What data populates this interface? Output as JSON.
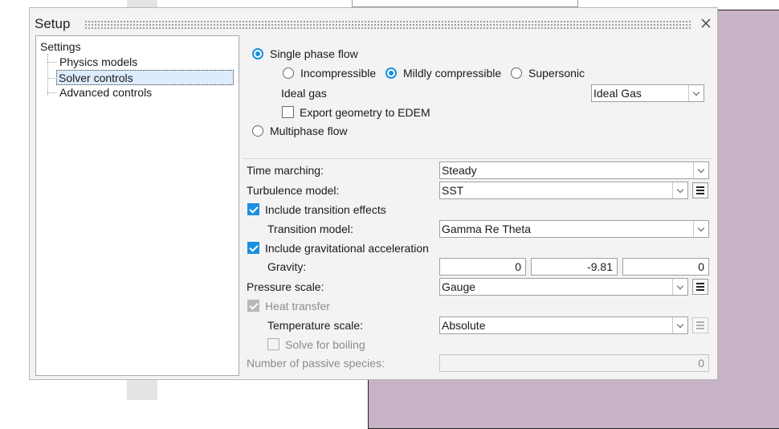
{
  "dialog": {
    "title": "Setup"
  },
  "tree": {
    "root": "Settings",
    "items": [
      "Physics models",
      "Solver controls",
      "Advanced controls"
    ],
    "selected_index": 1
  },
  "flow": {
    "single_phase_label": "Single phase flow",
    "single_phase_selected": true,
    "compressibility_options": [
      "Incompressible",
      "Mildly compressible",
      "Supersonic"
    ],
    "compressibility_selected": "Mildly compressible",
    "ideal_gas_label": "Ideal gas",
    "ideal_gas_value": "Ideal Gas",
    "export_edem_label": "Export geometry to EDEM",
    "export_edem_checked": false,
    "multiphase_label": "Multiphase flow",
    "multiphase_selected": false
  },
  "solver": {
    "time_marching_label": "Time marching:",
    "time_marching_value": "Steady",
    "turbulence_label": "Turbulence model:",
    "turbulence_value": "SST",
    "transition_effects_label": "Include transition effects",
    "transition_effects_checked": true,
    "transition_model_label": "Transition model:",
    "transition_model_value": "Gamma Re Theta",
    "gravity_accel_label": "Include gravitational acceleration",
    "gravity_accel_checked": true,
    "gravity_label": "Gravity:",
    "gravity_x": "0",
    "gravity_y": "-9.81",
    "gravity_z": "0",
    "pressure_scale_label": "Pressure scale:",
    "pressure_scale_value": "Gauge",
    "heat_transfer_label": "Heat transfer",
    "heat_transfer_checked": true,
    "temperature_scale_label": "Temperature scale:",
    "temperature_scale_value": "Absolute",
    "solve_boiling_label": "Solve for boiling",
    "solve_boiling_checked": false,
    "passive_species_label": "Number of passive species:",
    "passive_species_value": "0"
  },
  "colors": {
    "accent": "#1a8fe0",
    "selection_bg": "#dcecfc",
    "background_shape": "#c7b2c6"
  }
}
